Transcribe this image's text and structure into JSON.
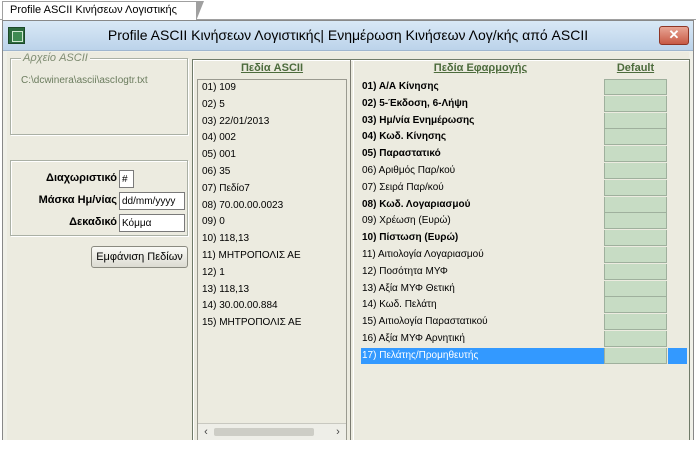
{
  "tab": {
    "label": "Profile ASCII Κινήσεων Λογιστικής"
  },
  "window": {
    "title": "Profile ASCII Κινήσεων Λογιστικής| Ενημέρωση Κινήσεων Λογ/κής από ASCII",
    "close_label": "✕",
    "app_icon": "app-icon"
  },
  "file_group": {
    "legend": "Αρχείο ASCII",
    "path": "C:\\dcwinera\\ascii\\ascIogtr.txt"
  },
  "options": {
    "separator_label": "Διαχωριστικό",
    "separator_value": "#",
    "date_mask_label": "Μάσκα Ημ/νίας",
    "date_mask_value": "dd/mm/yyyy",
    "decimal_label": "Δεκαδικό",
    "decimal_value": "Κόμμα"
  },
  "show_fields_button": "Εμφάνιση Πεδίων",
  "ascii_fields": {
    "header": "Πεδία ASCII",
    "items": [
      "01) 109",
      "02) 5",
      "03) 22/01/2013",
      "04) 002",
      "05) 001",
      "06) 35",
      "07) Πεδίο7",
      "08) 70.00.00.0023",
      "09) 0",
      "10) 118,13",
      "11) ΜΗΤΡΟΠΟΛΙΣ ΑΕ",
      "12) 1",
      "13) 118,13",
      "14) 30.00.00.884",
      "15) ΜΗΤΡΟΠΟΛΙΣ ΑΕ"
    ]
  },
  "app_fields": {
    "header": "Πεδία Εφαρμογής",
    "default_header": "Default",
    "selected_index": 16,
    "items": [
      {
        "label": "01) Α/Α Κίνησης",
        "bold": true
      },
      {
        "label": "02) 5-Έκδοση, 6-Λήψη",
        "bold": true
      },
      {
        "label": "03) Ημ/νία Ενημέρωσης",
        "bold": true
      },
      {
        "label": "04) Κωδ. Κίνησης",
        "bold": true
      },
      {
        "label": "05) Παραστατικό",
        "bold": true
      },
      {
        "label": "06) Αριθμός Παρ/κού",
        "bold": false
      },
      {
        "label": "07) Σειρά Παρ/κού",
        "bold": false
      },
      {
        "label": "08) Κωδ. Λογαριασμού",
        "bold": true
      },
      {
        "label": "09) Χρέωση (Ευρώ)",
        "bold": false
      },
      {
        "label": "10) Πίστωση (Ευρώ)",
        "bold": true
      },
      {
        "label": "11) Αιτιολογία Λογαριασμού",
        "bold": false
      },
      {
        "label": "12) Ποσότητα ΜΥΦ",
        "bold": false
      },
      {
        "label": "13) Αξία ΜΥΦ Θετική",
        "bold": false
      },
      {
        "label": "14) Κωδ. Πελάτη",
        "bold": false
      },
      {
        "label": "15) Αιτιολογία Παραστατικού",
        "bold": false
      },
      {
        "label": "16) Αξία ΜΥΦ Αρνητική",
        "bold": false
      },
      {
        "label": "17) Πελάτης/Προμηθευτής",
        "bold": false
      }
    ]
  }
}
